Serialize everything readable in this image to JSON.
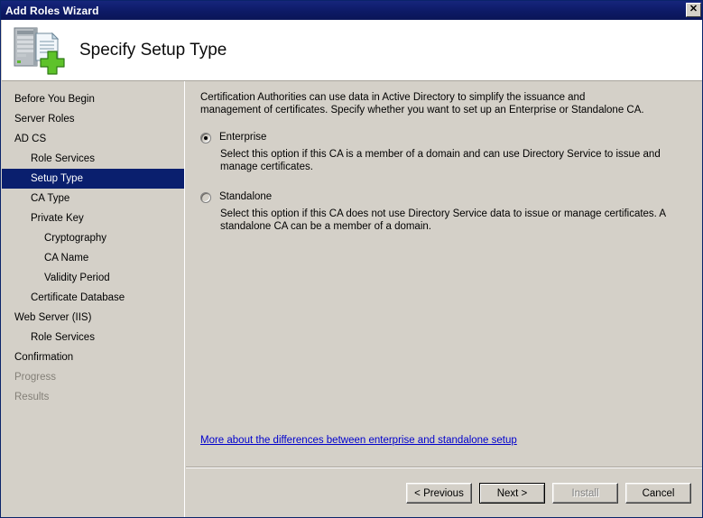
{
  "window": {
    "title": "Add Roles Wizard",
    "close_label": "✕",
    "close_icon": "close-icon"
  },
  "header": {
    "title": "Specify Setup Type",
    "icon": "server-certificate-add-icon"
  },
  "sidebar": {
    "items": [
      {
        "label": "Before You Begin",
        "level": 0,
        "selected": false,
        "disabled": false
      },
      {
        "label": "Server Roles",
        "level": 0,
        "selected": false,
        "disabled": false
      },
      {
        "label": "AD CS",
        "level": 0,
        "selected": false,
        "disabled": false
      },
      {
        "label": "Role Services",
        "level": 1,
        "selected": false,
        "disabled": false
      },
      {
        "label": "Setup Type",
        "level": 1,
        "selected": true,
        "disabled": false
      },
      {
        "label": "CA Type",
        "level": 1,
        "selected": false,
        "disabled": false
      },
      {
        "label": "Private Key",
        "level": 1,
        "selected": false,
        "disabled": false
      },
      {
        "label": "Cryptography",
        "level": 2,
        "selected": false,
        "disabled": false
      },
      {
        "label": "CA Name",
        "level": 2,
        "selected": false,
        "disabled": false
      },
      {
        "label": "Validity Period",
        "level": 2,
        "selected": false,
        "disabled": false
      },
      {
        "label": "Certificate Database",
        "level": 1,
        "selected": false,
        "disabled": false
      },
      {
        "label": "Web Server (IIS)",
        "level": 0,
        "selected": false,
        "disabled": false
      },
      {
        "label": "Role Services",
        "level": 1,
        "selected": false,
        "disabled": false
      },
      {
        "label": "Confirmation",
        "level": 0,
        "selected": false,
        "disabled": false
      },
      {
        "label": "Progress",
        "level": 0,
        "selected": false,
        "disabled": true
      },
      {
        "label": "Results",
        "level": 0,
        "selected": false,
        "disabled": true
      }
    ]
  },
  "content": {
    "intro": "Certification Authorities can use data in Active Directory to simplify the issuance and management of certificates. Specify whether you want to set up an Enterprise or Standalone CA.",
    "options": [
      {
        "id": "enterprise",
        "label": "Enterprise",
        "selected": true,
        "description": "Select this option if this CA is a member of a domain and can use Directory Service to issue and manage certificates."
      },
      {
        "id": "standalone",
        "label": "Standalone",
        "selected": false,
        "description": "Select this option if this CA does not use Directory Service data to issue or manage certificates. A standalone CA can be a member of a domain."
      }
    ],
    "more_link": "More about the differences between enterprise and standalone setup"
  },
  "footer": {
    "buttons": [
      {
        "label": "< Previous",
        "state": "normal"
      },
      {
        "label": "Next >",
        "state": "default"
      },
      {
        "label": "Install",
        "state": "disabled"
      },
      {
        "label": "Cancel",
        "state": "normal"
      }
    ]
  },
  "colors": {
    "titlebar": "#0d1a66",
    "selection": "#0a1f6e",
    "dialog_face": "#d4d0c8",
    "link": "#0000cc",
    "disabled_text": "#848078",
    "accent_green": "#4caf21"
  }
}
